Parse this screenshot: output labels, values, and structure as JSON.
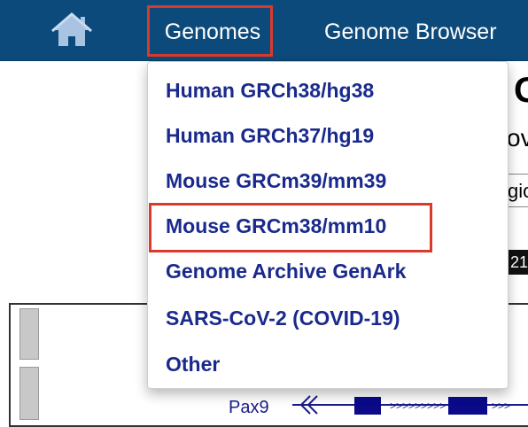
{
  "nav": {
    "home_icon": "home-icon",
    "genomes_label": "Genomes",
    "genome_browser_label": "Genome Browser"
  },
  "colors": {
    "navbar": "#0d4a7c",
    "menu_text": "#1a2a8c",
    "highlight": "#d93a2b"
  },
  "dropdown": {
    "items": [
      {
        "label": "Human GRCh38/hg38"
      },
      {
        "label": "Human GRCh37/hg19"
      },
      {
        "label": "Mouse GRCm39/mm39"
      },
      {
        "label": "Mouse GRCm38/mm10"
      },
      {
        "label": "Genome Archive GenArk"
      },
      {
        "label": "SARS-CoV-2 (COVID-19)"
      },
      {
        "label": "Other"
      }
    ]
  },
  "background": {
    "title_fragment": "G",
    "subtitle_fragment": "ov",
    "input_fragment": "gio",
    "black_fragment": "21",
    "gene_label": "Pax9"
  }
}
